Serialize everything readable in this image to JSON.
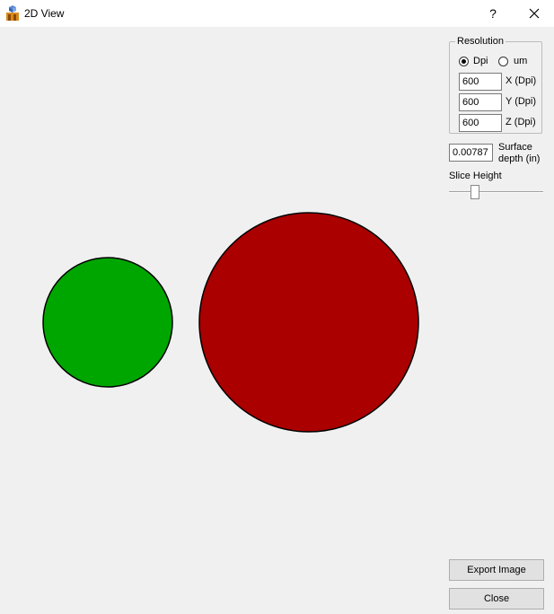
{
  "window": {
    "title": "2D View",
    "help": "?",
    "close_icon": "close-icon",
    "app_icon": "3d-printer-app-icon"
  },
  "resolution": {
    "legend": "Resolution",
    "unit_options": [
      {
        "label": "Dpi",
        "selected": true
      },
      {
        "label": "um",
        "selected": false
      }
    ],
    "x": {
      "value": "600",
      "label": "X (Dpi)"
    },
    "y": {
      "value": "600",
      "label": "Y (Dpi)"
    },
    "z": {
      "value": "600",
      "label": "Z (Dpi)"
    }
  },
  "surface": {
    "value": "0.00787",
    "label_line1": "Surface",
    "label_line2": "depth (in)"
  },
  "slice": {
    "label": "Slice Height",
    "level": 0.25
  },
  "shapes": [
    {
      "name": "green-circle",
      "color": "#00a600"
    },
    {
      "name": "red-circle",
      "color": "#aa0000"
    }
  ],
  "buttons": {
    "export": "Export Image",
    "close": "Close"
  }
}
